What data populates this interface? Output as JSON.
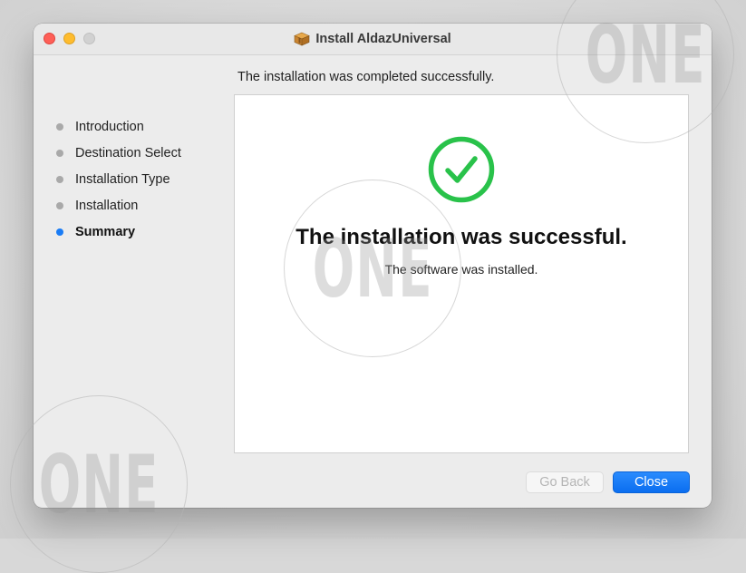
{
  "window": {
    "title": "Install AldazUniversal",
    "controls": [
      "close",
      "minimize",
      "zoom"
    ]
  },
  "header": {
    "text": "The installation was completed successfully."
  },
  "steps": [
    {
      "label": "Introduction",
      "active": false
    },
    {
      "label": "Destination Select",
      "active": false
    },
    {
      "label": "Installation Type",
      "active": false
    },
    {
      "label": "Installation",
      "active": false
    },
    {
      "label": "Summary",
      "active": true
    }
  ],
  "content": {
    "icon": "checkmark-circle-icon",
    "title": "The installation was successful.",
    "subtitle": "The software was installed."
  },
  "buttons": {
    "back_label": "Go Back",
    "back_enabled": false,
    "close_label": "Close"
  },
  "watermark": {
    "text": "ONE"
  },
  "colors": {
    "accent": "#1a7cf5",
    "success": "#29c24a",
    "close_light": "#fe5f57",
    "minimize_light": "#febc2e",
    "zoom_light": "#d1d1d1"
  }
}
